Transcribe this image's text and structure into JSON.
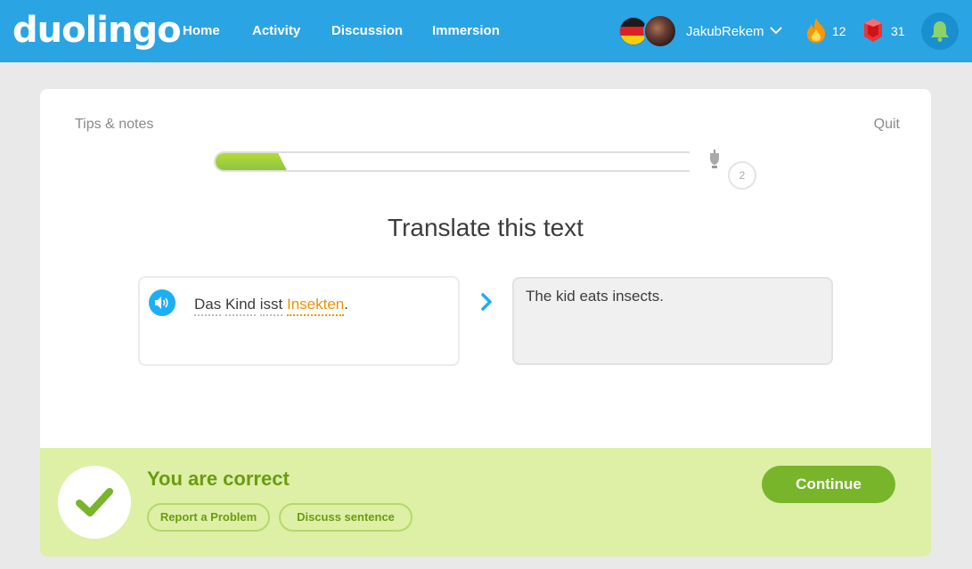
{
  "header": {
    "logo": "duolingo",
    "nav": [
      "Home",
      "Activity",
      "Discussion",
      "Immersion"
    ],
    "language_flag": "germany-flag",
    "username": "JakubRekem",
    "streak": "12",
    "gems": "31",
    "notifications_icon": "bell-icon"
  },
  "lesson": {
    "tips_label": "Tips & notes",
    "quit_label": "Quit",
    "progress_fraction": 0.15,
    "level_number": "2",
    "prompt_title": "Translate this text",
    "source_words": [
      "Das",
      "Kind",
      "isst",
      "Insekten"
    ],
    "source_punctuation": ".",
    "answer_text": "The kid eats insects."
  },
  "feedback": {
    "title": "You are correct",
    "report_label": "Report a Problem",
    "discuss_label": "Discuss sentence",
    "continue_label": "Continue"
  },
  "colors": {
    "brand_blue": "#2ba4e4",
    "success_green": "#78b52a",
    "feedback_bg": "#ddf0a5",
    "new_word_orange": "#f49000"
  }
}
